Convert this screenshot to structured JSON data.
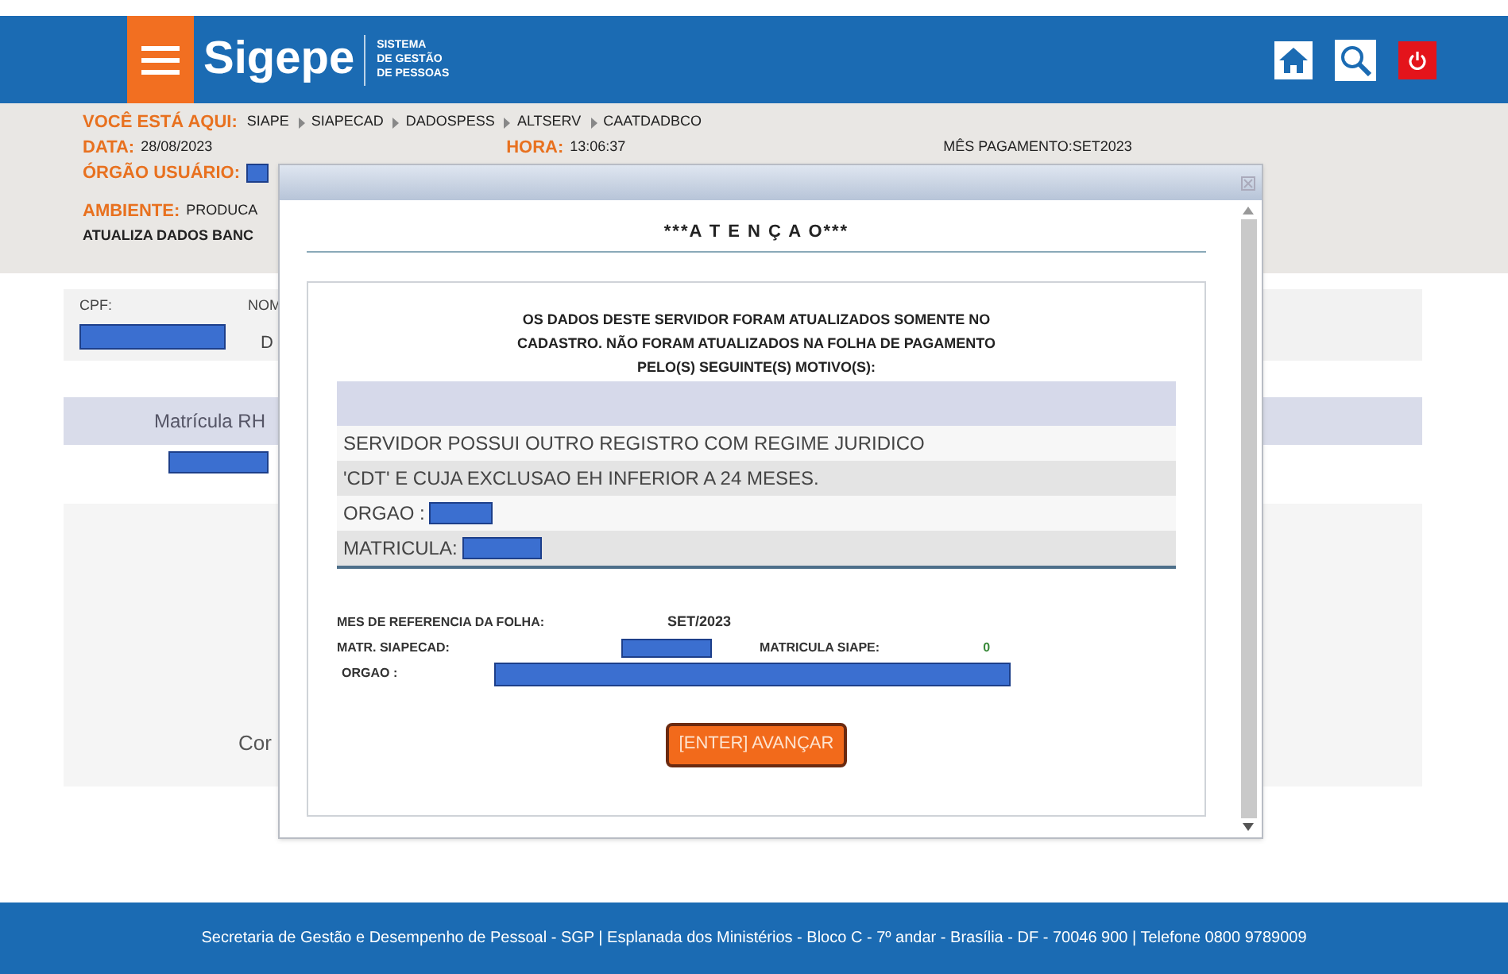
{
  "header": {
    "logo": "Sigepe",
    "subtitle": [
      "SISTEMA",
      "DE GESTÃO",
      "DE PESSOAS"
    ]
  },
  "info": {
    "location_label": "VOCÊ ESTÁ AQUI:",
    "breadcrumb": [
      "SIAPE",
      "SIAPECAD",
      "DADOSPESS",
      "ALTSERV",
      "CAATDADBCO"
    ],
    "date_label": "DATA:",
    "date": "28/08/2023",
    "time_label": "HORA:",
    "time": "13:06:37",
    "payment_month": "MÊS PAGAMENTO:SET2023",
    "org_label": "ÓRGÃO USUÁRIO:",
    "env_label": "AMBIENTE:",
    "env": "PRODUCA",
    "page_title": "ATUALIZA DADOS BANC"
  },
  "background": {
    "cpf_label": "CPF:",
    "name_label": "NOM",
    "cut_letter": "D",
    "column_header": "Matrícula RH",
    "bottom_text": "Cor"
  },
  "dialog": {
    "title": "***A T E N Ç A O***",
    "message": [
      "OS DADOS DESTE SERVIDOR FORAM ATUALIZADOS SOMENTE NO",
      "CADASTRO. NÃO FORAM ATUALIZADOS NA FOLHA DE PAGAMENTO",
      "PELO(S) SEGUINTE(S) MOTIVO(S):"
    ],
    "reasons": [
      {
        "kind": "text",
        "text": "SERVIDOR POSSUI OUTRO REGISTRO COM REGIME JURIDICO"
      },
      {
        "kind": "text",
        "text": "'CDT' E CUJA EXCLUSAO EH INFERIOR A 24 MESES."
      },
      {
        "kind": "field",
        "text": "ORGAO :"
      },
      {
        "kind": "field",
        "text": "MATRICULA:"
      }
    ],
    "ref_month_label": "MES DE REFERENCIA DA FOLHA:",
    "ref_month": "SET/2023",
    "siapecad_label": "MATR. SIAPECAD:",
    "siape_label": "MATRICULA SIAPE:",
    "siape": "0",
    "org_label": "ORGAO :",
    "button": "[ENTER] AVANÇAR"
  },
  "footer": "Secretaria de Gestão e Desempenho de Pessoal - SGP | Esplanada dos Ministérios - Bloco C - 7º andar - Brasília - DF - 70046 900 | Telefone 0800 9789009"
}
